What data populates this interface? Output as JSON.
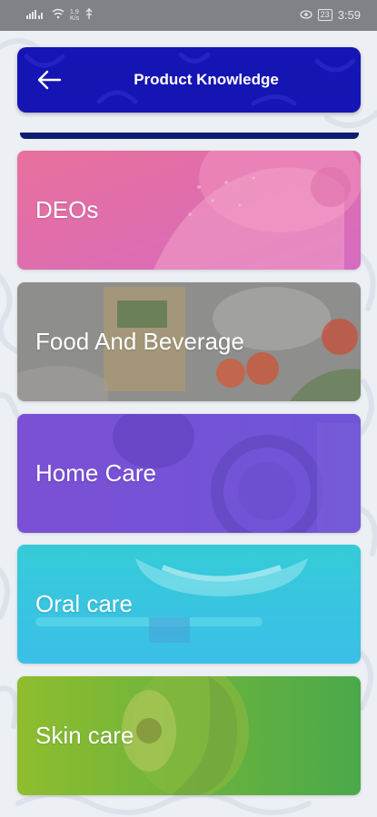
{
  "status_bar": {
    "net_speed_top": "1.9",
    "net_speed_bottom": "K/s",
    "battery": "23",
    "time": "3:59"
  },
  "header": {
    "title": "Product Knowledge",
    "back_icon": "arrow-left-icon"
  },
  "categories": [
    {
      "label": "DEOs"
    },
    {
      "label": "Food And Beverage"
    },
    {
      "label": "Home Care"
    },
    {
      "label": "Oral care"
    },
    {
      "label": "Skin care"
    }
  ],
  "colors": {
    "header": "#1515b4",
    "deos": "#e56aa5",
    "food": "#8d8d8b",
    "home": "#7654d6",
    "oral": "#3bc8e4",
    "skin": "#72b53b"
  }
}
